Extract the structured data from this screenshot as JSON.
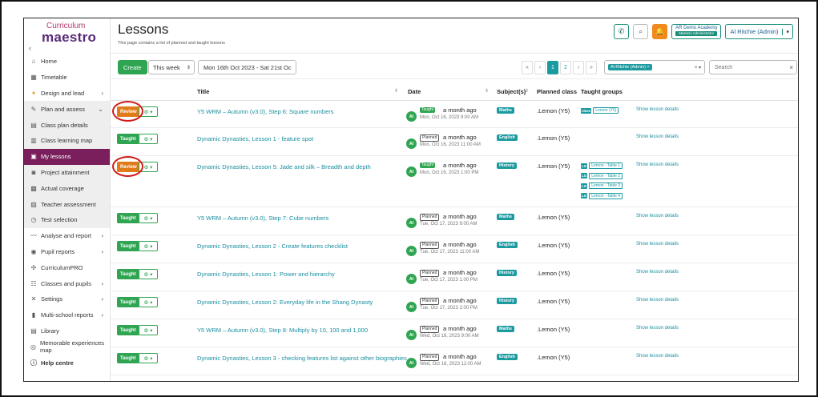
{
  "sidebar": {
    "logo_top": "Curriculum",
    "logo_bottom": "maestro",
    "collapse": "‹",
    "items": [
      {
        "label": "Home",
        "icon": "home-icon",
        "glyph": "⌂",
        "style": "",
        "chev": ""
      },
      {
        "label": "Timetable",
        "icon": "calendar-icon",
        "glyph": "▦",
        "style": "",
        "chev": ""
      },
      {
        "label": "Design and lead",
        "icon": "design-icon",
        "glyph": "✦",
        "style": "design",
        "chev": "›"
      },
      {
        "label": "Plan and assess",
        "icon": "edit-icon",
        "glyph": "✎",
        "style": "group",
        "chev": "⌄"
      },
      {
        "label": "Class plan details",
        "icon": "grid-icon",
        "glyph": "▤",
        "style": "sub",
        "chev": ""
      },
      {
        "label": "Class learning map",
        "icon": "map-icon",
        "glyph": "▥",
        "style": "sub",
        "chev": ""
      },
      {
        "label": "My lessons",
        "icon": "lessons-icon",
        "glyph": "▣",
        "style": "active",
        "chev": ""
      },
      {
        "label": "Project attainment",
        "icon": "chart-icon",
        "glyph": "◙",
        "style": "sub",
        "chev": ""
      },
      {
        "label": "Actual coverage",
        "icon": "coverage-icon",
        "glyph": "▩",
        "style": "sub",
        "chev": ""
      },
      {
        "label": "Teacher assessment",
        "icon": "clipboard-icon",
        "glyph": "▨",
        "style": "sub",
        "chev": ""
      },
      {
        "label": "Test selection",
        "icon": "stopwatch-icon",
        "glyph": "◷",
        "style": "sub",
        "chev": ""
      },
      {
        "label": "Analyse and report",
        "icon": "analyse-icon",
        "glyph": "〰",
        "style": "",
        "chev": "›"
      },
      {
        "label": "Pupil reports",
        "icon": "pupil-icon",
        "glyph": "◉",
        "style": "",
        "chev": "›"
      },
      {
        "label": "CurriculumPRO",
        "icon": "hub-icon",
        "glyph": "✣",
        "style": "",
        "chev": ""
      },
      {
        "label": "Classes and pupils",
        "icon": "people-icon",
        "glyph": "☷",
        "style": "",
        "chev": "›"
      },
      {
        "label": "Settings",
        "icon": "tools-icon",
        "glyph": "✕",
        "style": "",
        "chev": "›"
      },
      {
        "label": "Multi-school reports",
        "icon": "bars-icon",
        "glyph": "▮",
        "style": "",
        "chev": "›"
      },
      {
        "label": "Library",
        "icon": "library-icon",
        "glyph": "▤",
        "style": "",
        "chev": ""
      },
      {
        "label": "Memorable experiences map",
        "icon": "compass-icon",
        "glyph": "◎",
        "style": "",
        "chev": ""
      },
      {
        "label": "Help centre",
        "icon": "info-icon",
        "glyph": "ⓘ",
        "style": "bold",
        "chev": ""
      }
    ]
  },
  "header": {
    "title": "Lessons",
    "subtitle": "This page contains a list of planned and taught lessons",
    "phone_glyph": "✆",
    "search_glyph": "⌕",
    "bell_glyph": "🔔",
    "academy_name": "AR Demo Academy",
    "academy_role": "Maestro Administrator",
    "user_name": "Al Ritchie (Admin)",
    "user_caret": "▾"
  },
  "toolbar": {
    "create_label": "Create",
    "week_label": "This week",
    "week_caret": "⇕",
    "date_range": "Mon 16th Oct 2023 - Sat 21st Oc",
    "pager": [
      "«",
      "‹",
      "1",
      "2",
      "›",
      "»"
    ],
    "teacher_chip": "Al Ritchie (Admin) ×",
    "teacher_ctrl": "× ▾",
    "search_placeholder": "Search",
    "search_clear": "×"
  },
  "columns": {
    "title": "Title",
    "date": "Date",
    "subjects": "Subject(s)",
    "planned_class": "Planned class",
    "taught_groups": "Taught groups",
    "sort_glyph": "⇕"
  },
  "rows": [
    {
      "status": "Review",
      "status_class": "review",
      "ringed": true,
      "title": "Y5 WRM – Autumn (v3.0), Step 6: Square numbers",
      "initials": "Al",
      "badge": "Taught",
      "badge_class": "taught",
      "ago": "a month ago",
      "when": "Mon, Oct 16, 2023 9:00 AM",
      "subject": "Maths",
      "planned_class": ".Lemon (Y5)",
      "groups": [
        {
          "k": "class",
          "v": "Lemon (Y5)"
        }
      ],
      "details": "Show lesson details",
      "height": 34
    },
    {
      "status": "Taught",
      "status_class": "taught",
      "ringed": false,
      "title": "Dynamic Dynasties, Lesson 1 - feature spot",
      "initials": "Al",
      "badge": "Planned",
      "badge_class": "planned",
      "ago": "a month ago",
      "when": "Mon, Oct 16, 2023 11:00 AM",
      "subject": "English",
      "planned_class": ".Lemon (Y5)",
      "groups": [],
      "details": "Show lesson details",
      "height": 35
    },
    {
      "status": "Review",
      "status_class": "review",
      "ringed": true,
      "title": "Dynamic Dynasties, Lesson 5: Jade and silk – Breadth and depth",
      "initials": "Al",
      "badge": "Taught",
      "badge_class": "taught",
      "ago": "a month ago",
      "when": "Mon, Oct 16, 2023 1:00 PM",
      "subject": "History",
      "planned_class": ".Lemon (Y5)",
      "groups": [
        {
          "k": "LG",
          "v": "Lemon - Table 1"
        },
        {
          "k": "LG",
          "v": "Lemon - Table 2"
        },
        {
          "k": "LG",
          "v": "Lemon - Table 3"
        },
        {
          "k": "LG",
          "v": "Lemon - Table 4"
        }
      ],
      "details": "Show lesson details",
      "height": 64
    },
    {
      "status": "Taught",
      "status_class": "taught",
      "ringed": false,
      "title": "Y5 WRM – Autumn (v3.0), Step 7: Cube numbers",
      "initials": "Al",
      "badge": "Planned",
      "badge_class": "planned",
      "ago": "a month ago",
      "when": "Tue, Oct 17, 2023 9:00 AM",
      "subject": "Maths",
      "planned_class": ".Lemon (Y5)",
      "groups": [],
      "details": "Show lesson details",
      "height": 35
    },
    {
      "status": "Taught",
      "status_class": "taught",
      "ringed": false,
      "title": "Dynamic Dynasties, Lesson 2 - Create features checklist",
      "initials": "Al",
      "badge": "Planned",
      "badge_class": "planned",
      "ago": "a month ago",
      "when": "Tue, Oct 17, 2023 11:00 AM",
      "subject": "English",
      "planned_class": ".Lemon (Y5)",
      "groups": [],
      "details": "Show lesson details",
      "height": 35
    },
    {
      "status": "Taught",
      "status_class": "taught",
      "ringed": false,
      "title": "Dynamic Dynasties, Lesson 1: Power and hierarchy",
      "initials": "Al",
      "badge": "Planned",
      "badge_class": "planned",
      "ago": "a month ago",
      "when": "Tue, Oct 17, 2023 1:00 PM",
      "subject": "History",
      "planned_class": ".Lemon (Y5)",
      "groups": [],
      "details": "Show lesson details",
      "height": 35
    },
    {
      "status": "Taught",
      "status_class": "taught",
      "ringed": false,
      "title": "Dynamic Dynasties, Lesson 2: Everyday life in the Shang Dynasty",
      "initials": "Al",
      "badge": "Planned",
      "badge_class": "planned",
      "ago": "a month ago",
      "when": "Tue, Oct 17, 2023 2:00 PM",
      "subject": "History",
      "planned_class": ".Lemon (Y5)",
      "groups": [],
      "details": "Show lesson details",
      "height": 35
    },
    {
      "status": "Taught",
      "status_class": "taught",
      "ringed": false,
      "title": "Y5 WRM – Autumn (v3.0), Step 8: Multiply by 10, 100 and 1,000",
      "initials": "Al",
      "badge": "Planned",
      "badge_class": "planned",
      "ago": "a month ago",
      "when": "Wed, Oct 18, 2023 9:00 AM",
      "subject": "Maths",
      "planned_class": ".Lemon (Y5)",
      "groups": [],
      "details": "Show lesson details",
      "height": 35
    },
    {
      "status": "Taught",
      "status_class": "taught",
      "ringed": false,
      "title": "Dynamic Dynasties, Lesson 3 - checking features list against other biographies",
      "initials": "Al",
      "badge": "Planned",
      "badge_class": "planned",
      "ago": "a month ago",
      "when": "Wed, Oct 18, 2023 11:00 AM",
      "subject": "English",
      "planned_class": ".Lemon (Y5)",
      "groups": [],
      "details": "Show lesson details",
      "height": 35
    }
  ],
  "gear_glyph": "⚙ ▾",
  "colors": {
    "primary": "#2fa552",
    "review": "#e07b1a",
    "teal": "#1b9aa0",
    "active_nav": "#7a1f5c",
    "annotation": "#d21a1a"
  }
}
